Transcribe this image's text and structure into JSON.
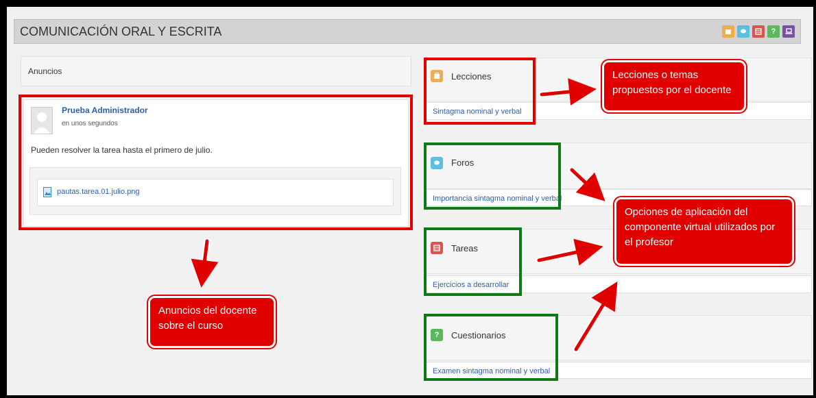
{
  "header": {
    "title": "COMUNICACIÓN ORAL Y ESCRITA",
    "icons": [
      {
        "name": "lecciones-icon",
        "color": "#f0ad4e"
      },
      {
        "name": "foros-icon",
        "color": "#5bc0de"
      },
      {
        "name": "tareas-icon",
        "color": "#d9534f"
      },
      {
        "name": "cuestionarios-icon",
        "color": "#5cb85c",
        "glyph": "?"
      },
      {
        "name": "laptop-icon",
        "color": "#7b4fa0"
      }
    ]
  },
  "announcements": {
    "title": "Anuncios",
    "post": {
      "author": "Prueba Administrador",
      "time": "en unos segundos",
      "body": "Pueden resolver la tarea hasta el primero de julio.",
      "attachment": "pautas.tarea.01.julio.png"
    }
  },
  "modules": [
    {
      "label": "Lecciones",
      "color": "#f0ad4e",
      "link": "Sintagma nominal y verbal"
    },
    {
      "label": "Foros",
      "color": "#5bc0de",
      "link": "Importancia sintagma nominal y verbal"
    },
    {
      "label": "Tareas",
      "color": "#d9534f",
      "link": "Ejercicios a desarrollar"
    },
    {
      "label": "Cuestionarios",
      "color": "#5cb85c",
      "glyph": "?",
      "link": "Examen sintagma nominal y verbal"
    }
  ],
  "callouts": {
    "lecciones": [
      "Lecciones o temas",
      "propuestos por el docente"
    ],
    "opciones": [
      "Opciones de aplicación del",
      "componente virtual utilizados por",
      "el profesor"
    ],
    "anuncios": [
      "Anuncios del docente",
      "sobre el curso"
    ]
  }
}
